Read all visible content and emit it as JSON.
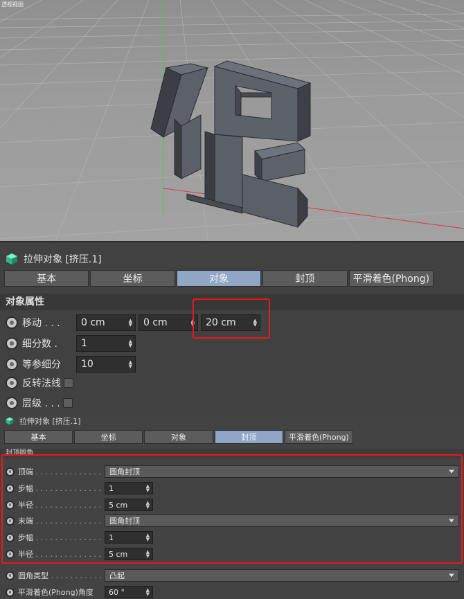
{
  "viewport": {
    "label": "透视视图"
  },
  "panel1": {
    "object_title": "拉伸对象 [挤压.1]",
    "tabs": [
      {
        "label": "基本",
        "active": false
      },
      {
        "label": "坐标",
        "active": false
      },
      {
        "label": "对象",
        "active": true
      },
      {
        "label": "封顶",
        "active": false
      },
      {
        "label": "平滑着色(Phong)",
        "active": false
      }
    ],
    "section_title": "对象属性",
    "move": {
      "label": "移动 . . .",
      "x": "0 cm",
      "y": "0 cm",
      "z": "20 cm"
    },
    "subdivisions": {
      "label": "细分数 .",
      "value": "1"
    },
    "isoparm": {
      "label": "等参细分",
      "value": "10"
    },
    "flip_normals": {
      "label": "反转法线"
    },
    "hierarchical": {
      "label": "层级 . . ."
    }
  },
  "panel2": {
    "object_title": "拉伸对象 [挤压.1]",
    "tabs": [
      {
        "label": "基本",
        "active": false
      },
      {
        "label": "坐标",
        "active": false
      },
      {
        "label": "对象",
        "active": false
      },
      {
        "label": "封顶",
        "active": true
      },
      {
        "label": "平滑着色(Phong)",
        "active": false
      }
    ],
    "section_title": "封顶圆角",
    "start": {
      "label": "顶端",
      "dots": ". . . . . . . . . . . . . .",
      "value": "圆角封顶"
    },
    "start_steps": {
      "label": "步幅",
      "dots": ". . . . . . . . . . . . . .",
      "value": "1"
    },
    "start_radius": {
      "label": "半径",
      "dots": ". . . . . . . . . . . . . .",
      "value": "5 cm"
    },
    "end": {
      "label": "末端",
      "dots": ". . . . . . . . . . . . . .",
      "value": "圆角封顶"
    },
    "end_steps": {
      "label": "步幅",
      "dots": ". . . . . . . . . . . . . .",
      "value": "1"
    },
    "end_radius": {
      "label": "半径",
      "dots": ". . . . . . . . . . . . . .",
      "value": "5 cm"
    },
    "fillet_type": {
      "label": "圆角类型",
      "dots": ". . . . . . . . . . .",
      "value": "凸起"
    },
    "phong_angle": {
      "label": "平滑着色(Phong)角度",
      "value": "60 °"
    }
  },
  "colors": {
    "highlight_box": "#e8191a",
    "active_tab": "#8fa6c6",
    "object_icon": "#3fd0a4"
  }
}
